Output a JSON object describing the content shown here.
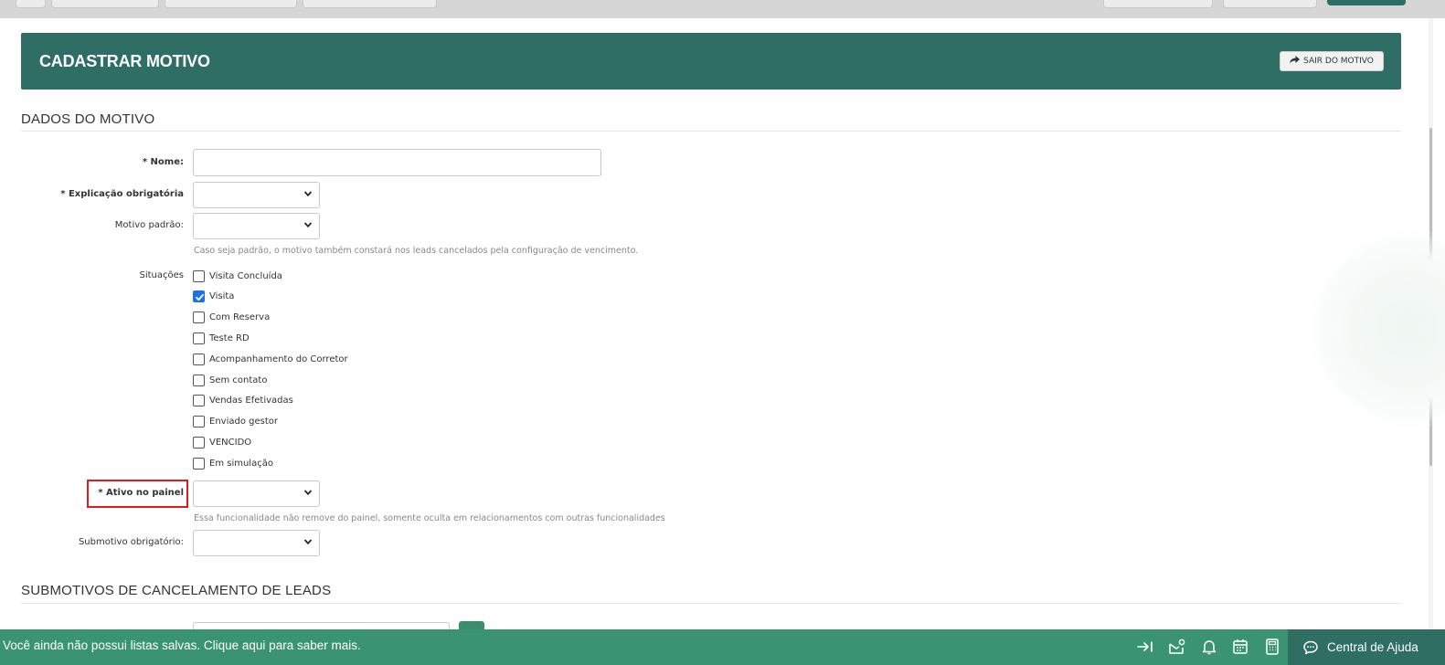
{
  "header": {
    "title": "CADASTRAR MOTIVO",
    "exit_label": "SAIR DO MOTIVO"
  },
  "sections": {
    "dados": "DADOS DO MOTIVO",
    "submotivos": "SUBMOTIVOS DE CANCELAMENTO DE LEADS"
  },
  "form": {
    "nome_label": "* Nome:",
    "nome_value": "",
    "explicacao_label": "* Explicação obrigatória",
    "explicacao_value": "",
    "motivo_padrao_label": "Motivo padrão:",
    "motivo_padrao_value": "",
    "motivo_padrao_help": "Caso seja padrão, o motivo também constará nos leads cancelados pela configuração de vencimento.",
    "situacoes_label": "Situações",
    "situacoes": [
      {
        "label": "Visita Concluída",
        "checked": false
      },
      {
        "label": "Visita",
        "checked": true
      },
      {
        "label": "Com Reserva",
        "checked": false
      },
      {
        "label": "Teste RD",
        "checked": false
      },
      {
        "label": "Acompanhamento do Corretor",
        "checked": false
      },
      {
        "label": "Sem contato",
        "checked": false
      },
      {
        "label": "Vendas Efetivadas",
        "checked": false
      },
      {
        "label": "Enviado gestor",
        "checked": false
      },
      {
        "label": "VENCIDO",
        "checked": false
      },
      {
        "label": "Em simulação",
        "checked": false
      }
    ],
    "ativo_label": "* Ativo no painel",
    "ativo_value": "",
    "ativo_help": "Essa funcionalidade não remove do painel, somente oculta em relacionamentos com outras funcionalidades",
    "submotivo_label": "Submotivo obrigatório:",
    "submotivo_value": ""
  },
  "bottom_bar": {
    "message": "Você ainda não possui listas salvas. Clique aqui para saber mais.",
    "icons": [
      "collapse-arrow-icon",
      "mail-settings-icon",
      "bell-icon",
      "calendar-icon",
      "calculator-icon"
    ],
    "help_center": "Central de Ajuda"
  },
  "colors": {
    "header_bg": "#2f6e64",
    "bottom_bar_bg": "#3a9472",
    "help_center_bg": "#2e6e63",
    "highlight_border": "#e01b1b",
    "checkbox_checked": "#1a73e8"
  }
}
